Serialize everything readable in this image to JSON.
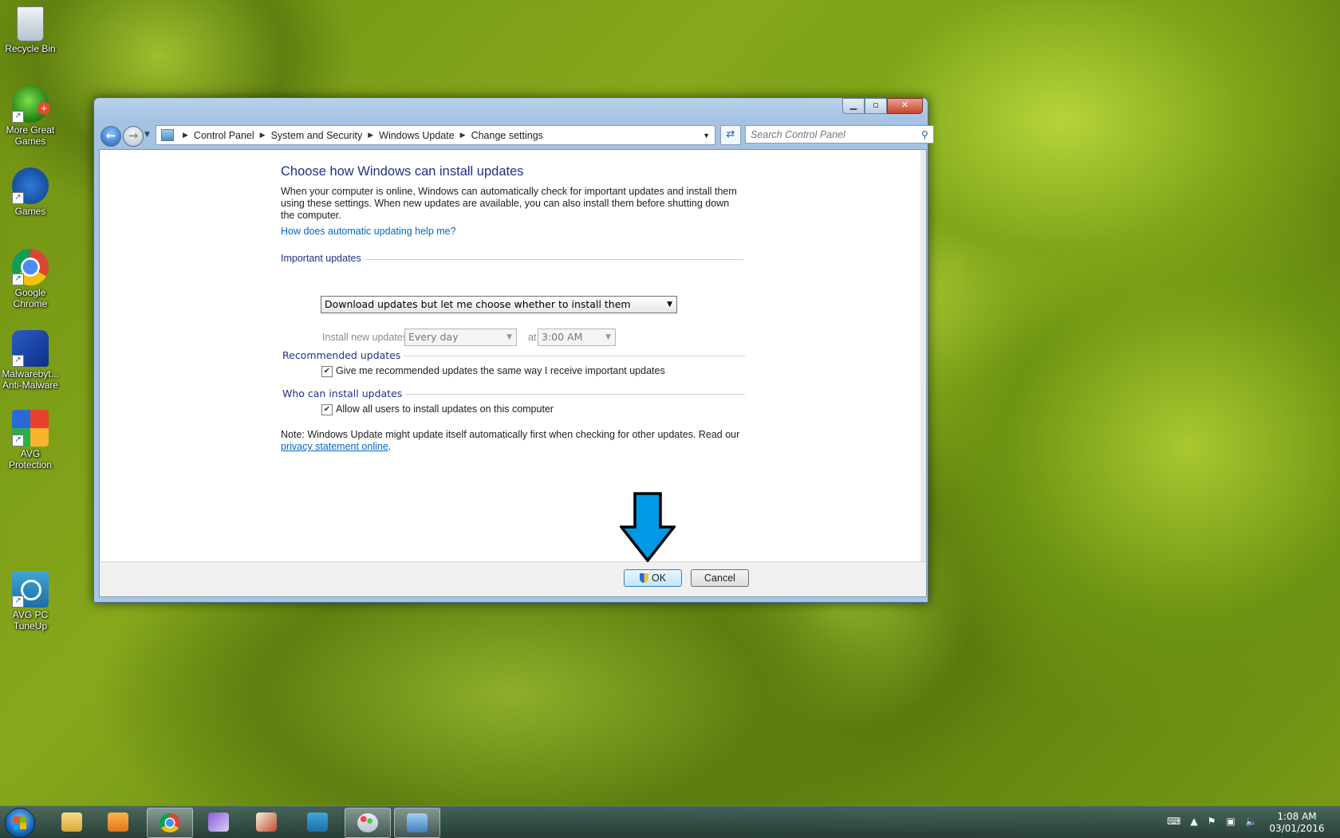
{
  "desktop": {
    "icons": [
      {
        "label": "Recycle Bin",
        "icon": "recycle-bin-icon"
      },
      {
        "label": "More Great Games",
        "icon": "games-frog-icon"
      },
      {
        "label": "Games",
        "icon": "big-fish-games-icon"
      },
      {
        "label": "Google Chrome",
        "icon": "chrome-icon"
      },
      {
        "label": "Malwarebyt... Anti-Malware",
        "icon": "malwarebytes-icon"
      },
      {
        "label": "AVG Protection",
        "icon": "avg-protection-icon"
      },
      {
        "label": "AVG PC TuneUp",
        "icon": "avg-tuneup-icon"
      }
    ]
  },
  "window": {
    "breadcrumb": [
      "Control Panel",
      "System and Security",
      "Windows Update",
      "Change settings"
    ],
    "search_placeholder": "Search Control Panel",
    "title": "Choose how Windows can install updates",
    "description": "When your computer is online, Windows can automatically check for important updates and install them using these settings. When new updates are available, you can also install them before shutting down the computer.",
    "help_link": "How does automatic updating help me?",
    "important": {
      "heading": "Important updates",
      "selected": "Download updates but let me choose whether to install them",
      "install_label": "Install new updates:",
      "day": "Every day",
      "at_label": "at",
      "time": "3:00 AM"
    },
    "recommended": {
      "heading": "Recommended updates",
      "checkbox_label": "Give me recommended updates the same way I receive important updates",
      "checked": true
    },
    "who": {
      "heading": "Who can install updates",
      "checkbox_label": "Allow all users to install updates on this computer",
      "checked": true
    },
    "note_text": "Note: Windows Update might update itself automatically first when checking for other updates.  Read our",
    "note_link": "privacy statement online",
    "note_end": ".",
    "ok_label": "OK",
    "cancel_label": "Cancel"
  },
  "taskbar": {
    "items": [
      {
        "icon": "explorer-icon",
        "active": false
      },
      {
        "icon": "media-player-icon",
        "active": false
      },
      {
        "icon": "chrome-icon",
        "active": true
      },
      {
        "icon": "solitaire-icon",
        "active": false
      },
      {
        "icon": "cards-icon",
        "active": false
      },
      {
        "icon": "avg-tuneup-icon",
        "active": false
      },
      {
        "icon": "paint-icon",
        "active": true
      },
      {
        "icon": "control-panel-icon",
        "active": true
      }
    ],
    "time": "1:08 AM",
    "date": "03/01/2016"
  },
  "colors": {
    "accent": "#1e3287",
    "link": "#0066cc",
    "arrow": "#0099e6"
  }
}
